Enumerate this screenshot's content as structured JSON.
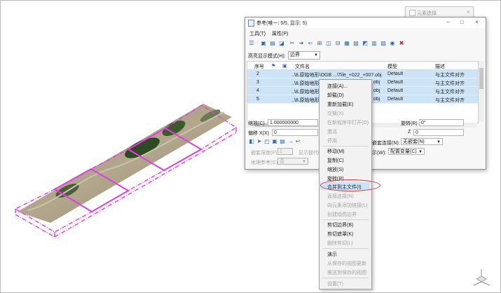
{
  "element_window": {
    "title": "元素选择"
  },
  "dialog": {
    "title": "参考(唯一: 5/5, 显示: 5)",
    "menu": [
      "工具(T)",
      "属性(P)"
    ],
    "display_mode_label": "高亮显示模式(H):",
    "display_mode_value": "边界",
    "columns": [
      "序号",
      "文件名",
      "模型",
      "描述"
    ],
    "rows": [
      {
        "index": "2",
        "file": "..\\8.原始地形\\OGB ...\\Tile_+022_+007.obj",
        "model": "Default",
        "desc": "与主文件对齐"
      },
      {
        "index": "3",
        "file": "..\\8.原始地形\\O",
        "file_tail": "obj",
        "model": "Default",
        "desc": "与主文件对齐"
      },
      {
        "index": "4",
        "file": "..\\8.原始地形\\O",
        "file_tail": "obj",
        "model": "Default",
        "desc": "与主文件对齐"
      },
      {
        "index": "5",
        "file": "..\\8.原始地形\\O",
        "file_tail": "obj",
        "model": "Default",
        "desc": "与主文件对齐"
      }
    ],
    "scale_label": "缩放(C)",
    "scale_value": "1.000000000",
    "rotate_label": "旋转(R)",
    "rotate_value": "0°",
    "offset_x_label": "偏移 X(X)",
    "offset_x_value": "0",
    "z_label": "Z",
    "z_value": "0",
    "nested_attach_label": "嵌套连接(N):",
    "nested_attach_value": "无嵌套(N)",
    "nested_depth_label": "嵌套深度(P):",
    "nested_depth_value": "1",
    "display_label": "显示替代(",
    "show_label": "示(W):",
    "config_value": "配置变量(C)",
    "geo_ref_label": "地理参考(G):",
    "geo_ref_value": "否"
  },
  "context_menu": {
    "items": [
      {
        "label": "连接(A)...",
        "enabled": true
      },
      {
        "label": "卸载(D)",
        "enabled": true
      },
      {
        "label": "重新加载(E)",
        "enabled": true
      },
      {
        "label": "交换(X)",
        "enabled": false
      },
      {
        "label": "在新程序中打开(O)",
        "enabled": false
      },
      {
        "label": "激活",
        "enabled": false
      },
      {
        "label": "停用",
        "enabled": false
      },
      {
        "label": "移动(M)",
        "enabled": true
      },
      {
        "label": "复制(C)",
        "enabled": true
      },
      {
        "label": "缩放(S)",
        "enabled": true
      },
      {
        "label": "旋转(R)",
        "enabled": true
      },
      {
        "label": "合并到主文件(I)",
        "enabled": true,
        "highlighted": true
      },
      {
        "label": "直接连接(N)",
        "enabled": false
      },
      {
        "label": "向元素添加链接(L)",
        "enabled": false
      },
      {
        "label": "创建绘图边界",
        "enabled": false
      },
      {
        "label": "剪切边界(B)",
        "enabled": true
      },
      {
        "label": "剪切遮罩(K)",
        "enabled": true
      },
      {
        "label": "删除剪切(L)",
        "enabled": false
      },
      {
        "label": "演示",
        "enabled": true
      },
      {
        "label": "从保存的视图更新",
        "enabled": false
      },
      {
        "label": "推送到保存的视图",
        "enabled": false
      },
      {
        "label": "设置(T)",
        "enabled": false
      }
    ]
  },
  "colors": {
    "boundary": "#e43ae4",
    "highlight": "#cde4f7",
    "annotation": "#e03a3a"
  }
}
